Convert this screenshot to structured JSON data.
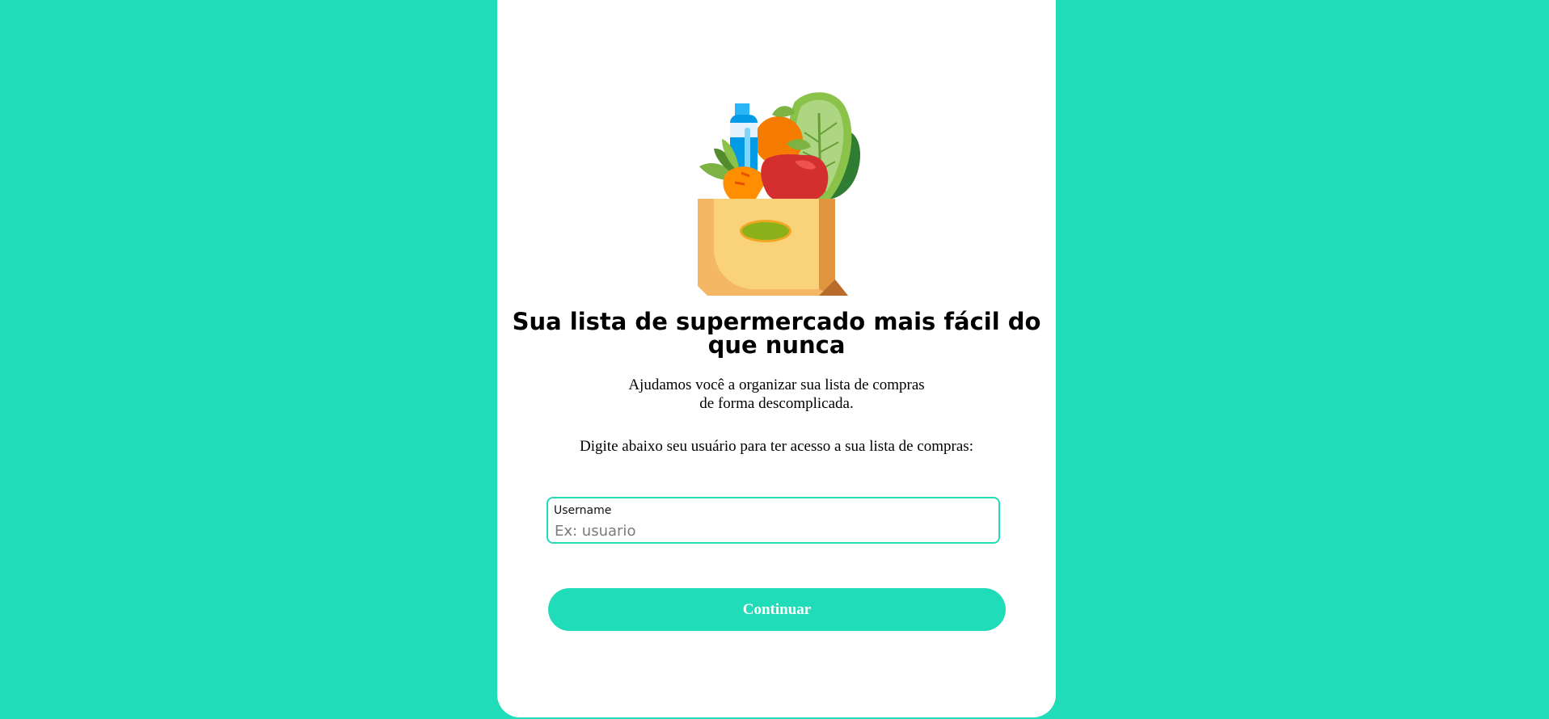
{
  "hero": {
    "illustration": "grocery-bag-icon",
    "title": "Sua lista de supermercado mais fácil do que nunca",
    "subtitle_line1": "Ajudamos você a organizar sua lista de compras",
    "subtitle_line2": "de forma descomplicada."
  },
  "form": {
    "instruction": "Digite abaixo seu usuário para ter acesso a sua lista de compras:",
    "username_label": "Username",
    "username_placeholder": "Ex: usuario",
    "username_value": "",
    "submit_label": "Continuar"
  },
  "colors": {
    "background": "#21dcb8",
    "card": "#ffffff",
    "accent": "#21dcb8"
  }
}
